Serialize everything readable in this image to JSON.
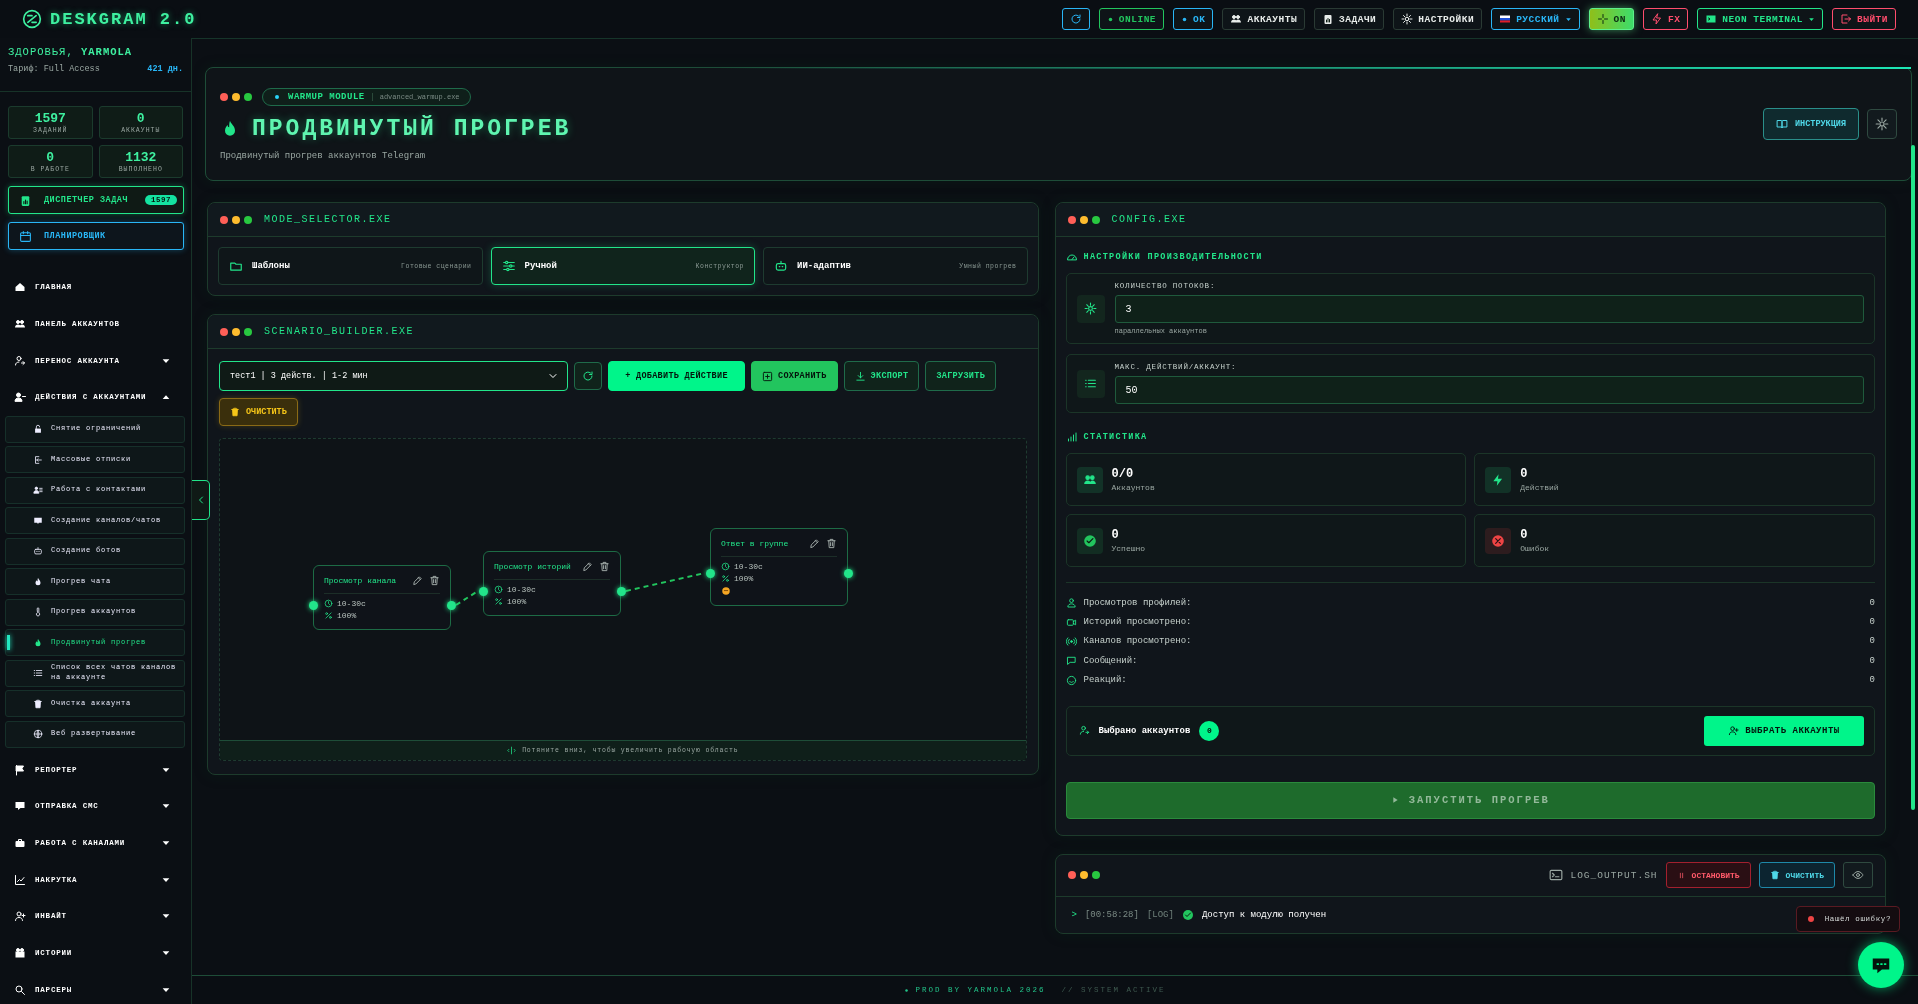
{
  "top_bar": {
    "logo": "DESKGRAM 2.0",
    "buttons": [
      {
        "kind": "icon",
        "color": "#29b6f6"
      },
      {
        "kind": "status",
        "label": "ONLINE",
        "color": "#22c55e"
      },
      {
        "kind": "status",
        "label": "OK",
        "color": "#29b6f6"
      },
      {
        "kind": "button",
        "label": "АККАУНТЫ",
        "color": "#e8ecea"
      },
      {
        "kind": "button",
        "label": "ЗАДАЧИ",
        "color": "#e8ecea"
      },
      {
        "kind": "button",
        "label": "НАСТРОЙКИ",
        "color": "#e8ecea"
      },
      {
        "kind": "dropdown",
        "label": "РУССКИЙ",
        "color": "#29b6f6"
      },
      {
        "kind": "toggle",
        "label": "ON",
        "on": true,
        "color": "#5ef08a"
      },
      {
        "kind": "button",
        "label": "FX",
        "color": "#ff4d6d"
      },
      {
        "kind": "dropdown",
        "label": "NEON TERMINAL",
        "color": "#22e58a"
      },
      {
        "kind": "button",
        "label": "ВЫЙТИ",
        "color": "#ff4d6d"
      }
    ]
  },
  "sidebar": {
    "greeting": "ЗДОРОВЬЯ, **YARMOLA**",
    "tariff": "Тариф: Full Access",
    "days": "421 дн.",
    "stats": [
      {
        "value": "1597",
        "label": "ЗАДАНИЙ"
      },
      {
        "value": "0",
        "label": "АККАУНТЫ"
      },
      {
        "value": "0",
        "label": "В РАБОТЕ"
      },
      {
        "value": "1132",
        "label": "ВЫПОЛНЕНО"
      }
    ],
    "dispatcher": {
      "label": "ДИСПЕТЧЕР ЗАДАЧ",
      "badge": "1597"
    },
    "scheduler": {
      "label": "ПЛАНИРОВЩИК"
    },
    "nav": [
      {
        "label": "ГЛАВНАЯ"
      },
      {
        "label": "ПАНЕЛЬ АККАУНТОВ"
      },
      {
        "label": "ПЕРЕНОС АККАУНТА",
        "expanded": false
      },
      {
        "label": "ДЕЙСТВИЯ С АККАУНТАМИ",
        "expanded": true,
        "children": [
          {
            "label": "Снятие ограничений",
            "selected": false
          },
          {
            "label": "Массовые отписки",
            "selected": false
          },
          {
            "label": "Работа с контактами",
            "selected": false
          },
          {
            "label": "Создание каналов/чатов",
            "selected": false
          },
          {
            "label": "Создание ботов",
            "selected": false
          },
          {
            "label": "Прогрев чата",
            "selected": false
          },
          {
            "label": "Прогрев аккаунтов",
            "selected": false
          },
          {
            "label": "Продвинутый прогрев",
            "selected": true
          },
          {
            "label": "Список всех чатов каналов на аккаунте",
            "selected": false
          },
          {
            "label": "Очистка аккаунта",
            "selected": false
          },
          {
            "label": "Веб развертывание",
            "selected": false
          }
        ]
      },
      {
        "label": "РЕПОРТЕР",
        "expanded": false
      },
      {
        "label": "ОТПРАВКА СМС",
        "expanded": false
      },
      {
        "label": "РАБОТА С КАНАЛАМИ",
        "expanded": false
      },
      {
        "label": "НАКРУТКА",
        "expanded": false
      },
      {
        "label": "ИНВАЙТ",
        "expanded": false
      },
      {
        "label": "ИСТОРИИ",
        "expanded": false
      },
      {
        "label": "ПАРСЕРЫ",
        "expanded": false
      }
    ]
  },
  "header": {
    "module": "WARMUP MODULE",
    "file": "advanced_warmup.exe",
    "title": "ПРОДВИНУТЫЙ ПРОГРЕВ",
    "subtitle": "Продвинутый прогрев аккаунтов Telegram",
    "help_button": "ИНСТРУКЦИЯ"
  },
  "mode_selector": {
    "title": "MODE_SELECTOR.EXE",
    "modes": [
      {
        "name": "Шаблоны",
        "caption": "Готовые сценарии",
        "selected": false
      },
      {
        "name": "Ручной",
        "caption": "Конструктор",
        "selected": true
      },
      {
        "name": "ИИ-адаптив",
        "caption": "Умный прогрев",
        "selected": false
      }
    ]
  },
  "scenario_builder": {
    "title": "SCENARIO_BUILDER.EXE",
    "scenario": "тест1 | 3 действ. | 1-2 мин",
    "buttons": [
      "+ ДОБАВИТЬ ДЕЙСТВИЕ",
      "СОХРАНИТЬ",
      "ЭКСПОРТ",
      "ЗАГРУЗИТЬ"
    ],
    "clear_button": "ОЧИСТИТЬ",
    "nodes": [
      {
        "kind": "view",
        "title": "Просмотр канала",
        "delay": "10-30с",
        "chance": "100%"
      },
      {
        "kind": "view",
        "title": "Просмотр историй",
        "delay": "10-30с",
        "chance": "100%"
      },
      {
        "kind": "reply",
        "title": "Ответ в группе",
        "delay": "10-30с",
        "chance": "100%"
      }
    ],
    "hint": "Потяните вниз, чтобы увеличить рабочую область"
  },
  "config": {
    "title": "CONFIG.EXE",
    "performance_title": "НАСТРОЙКИ ПРОИЗВОДИТЕЛЬНОСТИ",
    "fields": [
      {
        "label": "КОЛИЧЕСТВО ПОТОКОВ:",
        "value": "3",
        "hint": "параллельных аккаунтов"
      },
      {
        "label": "МАКС. ДЕЙСТВИЙ/АККАУНТ:",
        "value": "50"
      }
    ],
    "stats_title": "СТАТИСТИКА",
    "stats": [
      {
        "value": "0/0",
        "label": "Аккаунтов",
        "color": "#22e58a"
      },
      {
        "value": "0",
        "label": "Действий",
        "color": "#22e58a"
      },
      {
        "value": "0",
        "label": "Успешно",
        "color": "#22c55e"
      },
      {
        "value": "0",
        "label": "Ошибок",
        "color": "#ef4444"
      }
    ],
    "counters": [
      {
        "label": "Просмотров профилей:",
        "value": "0"
      },
      {
        "label": "Историй просмотрено:",
        "value": "0"
      },
      {
        "label": "Каналов просмотрено:",
        "value": "0"
      },
      {
        "label": "Сообщений:",
        "value": "0"
      },
      {
        "label": "Реакций:",
        "value": "0"
      }
    ],
    "selected_label": "Выбрано аккаунтов",
    "selected_count": "0",
    "select_button": "ВЫБРАТЬ АККАУНТЫ",
    "launch": {
      "label": "ЗАПУСТИТЬ ПРОГРЕВ",
      "disabled": true
    }
  },
  "log": {
    "title": "LOG_OUTPUT.SH",
    "stop_button": "ОСТАНОВИТЬ",
    "clear_button": "ОЧИСТИТЬ",
    "lines": [
      {
        "prompt": ">",
        "time": "[00:58:28]",
        "tag": "[LOG]",
        "text": "Доступ к модулю получен",
        "ok": true
      }
    ]
  },
  "feedback": "Нашёл ошибку?",
  "footer": {
    "credit": "PROD BY YARMOLA 2026",
    "status": "// SYSTEM ACTIVE"
  }
}
